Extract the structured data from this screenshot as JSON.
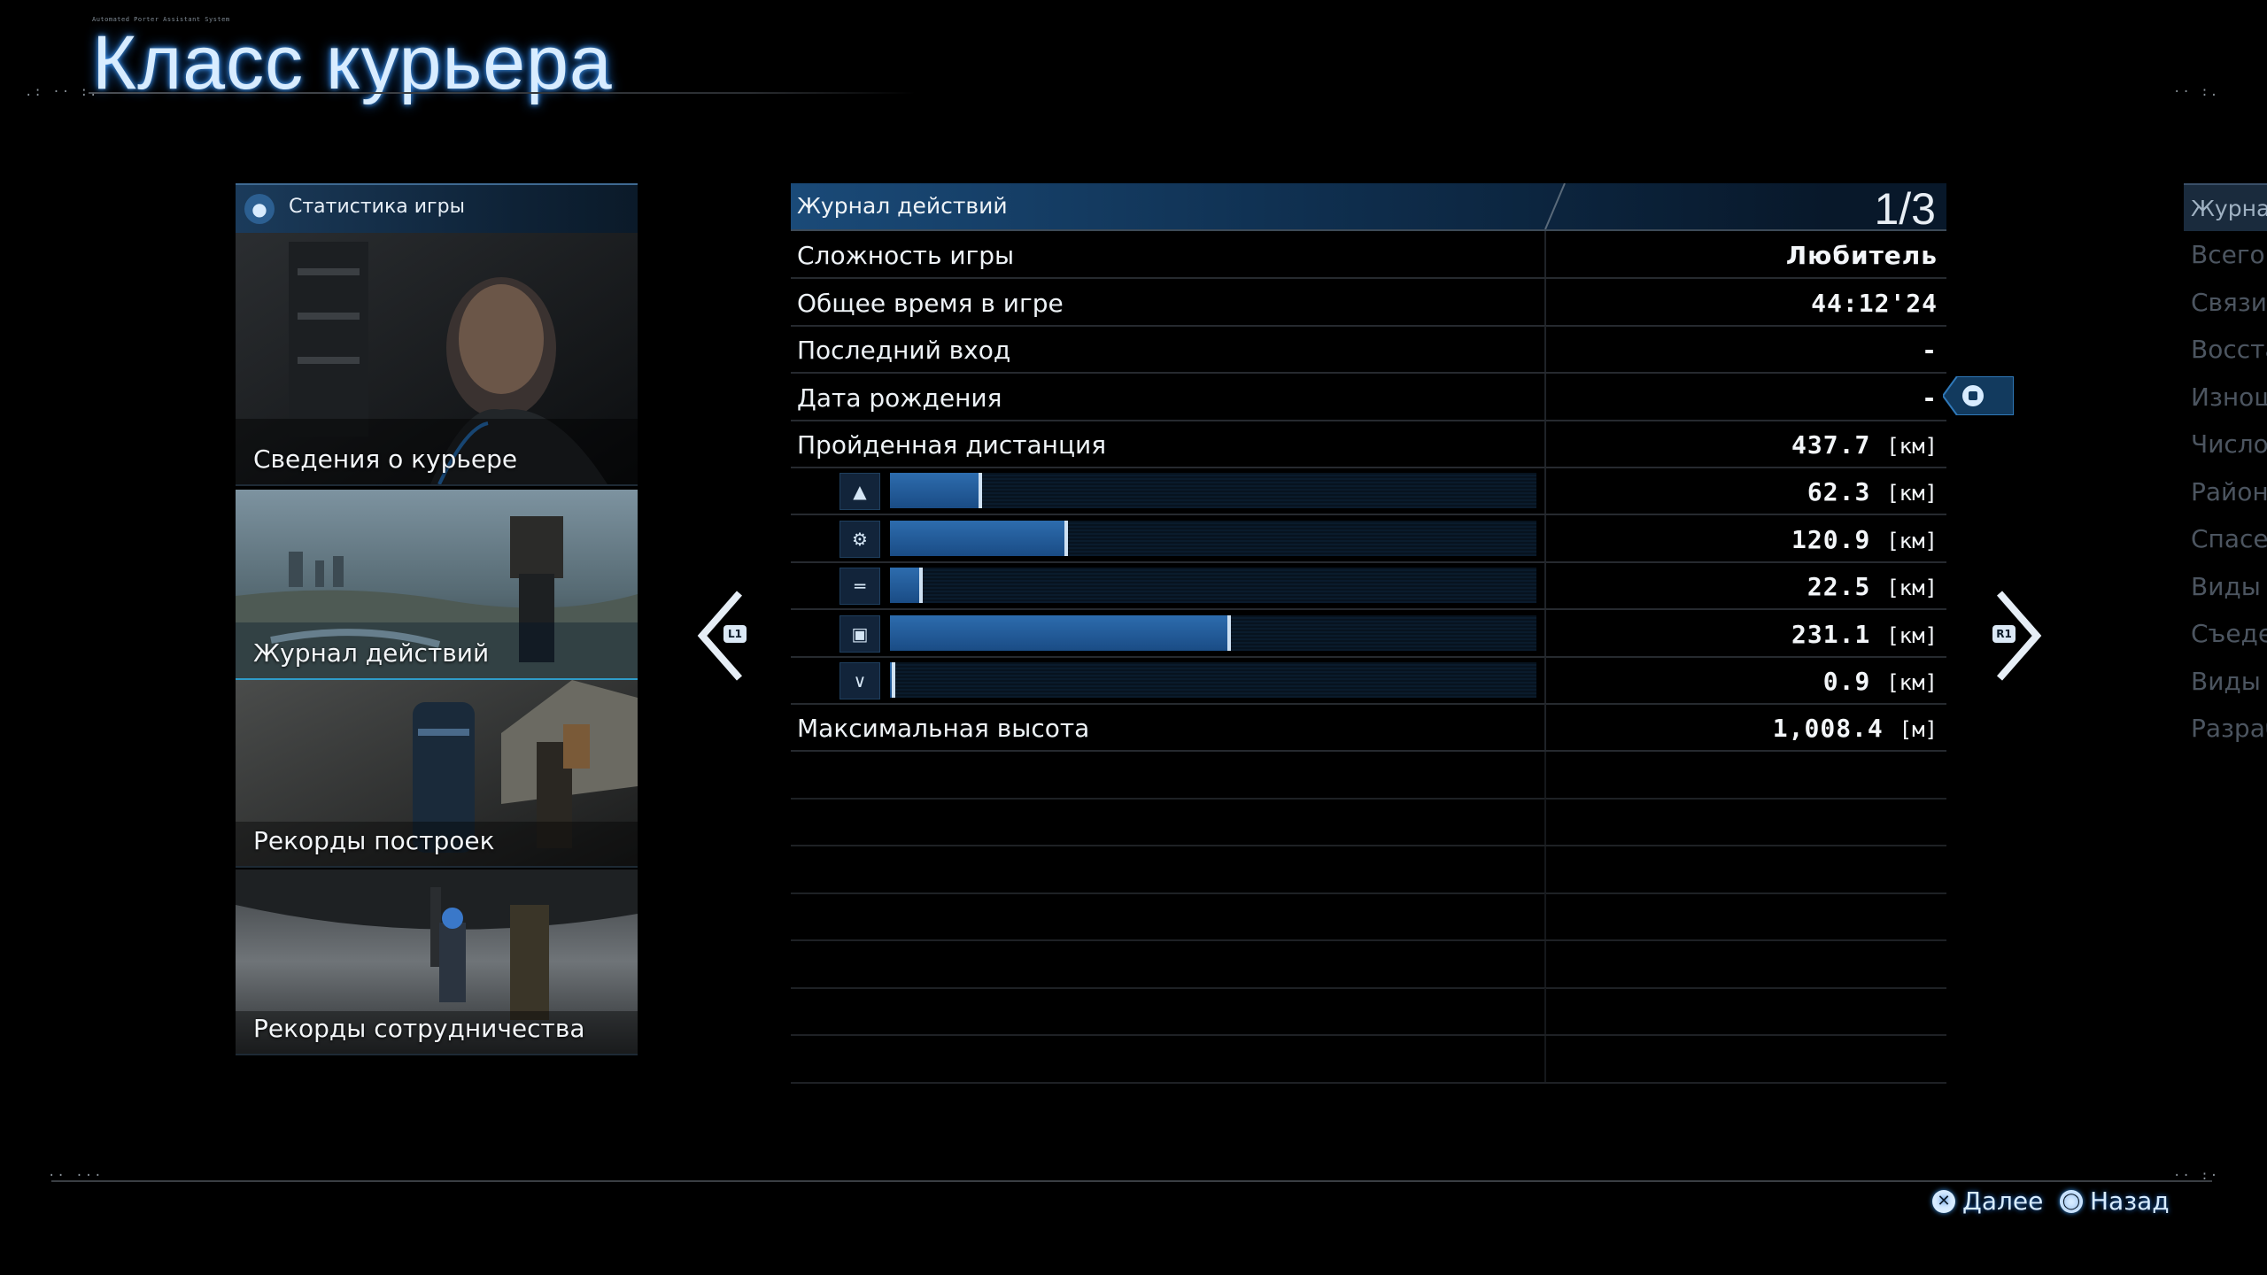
{
  "header": {
    "system_label": "Automated Porter Assistant System",
    "title": "Класс курьера"
  },
  "left_menu": {
    "header_label": "Статистика игры",
    "header_icon": "gamepad-icon",
    "items": [
      {
        "label": "Сведения о курьере",
        "active": false
      },
      {
        "label": "Журнал действий",
        "active": true
      },
      {
        "label": "Рекорды построек",
        "active": false
      },
      {
        "label": "Рекорды сотрудничества",
        "active": false
      }
    ]
  },
  "stats": {
    "section_title": "Журнал действий",
    "page_indicator": "1/3",
    "rows": [
      {
        "label": "Сложность игры",
        "value": "Любитель"
      },
      {
        "label": "Общее время в игре",
        "value": "44:12'24"
      },
      {
        "label": "Последний вход",
        "value": "-"
      },
      {
        "label": "Дата рождения",
        "value": "-"
      },
      {
        "label": "Пройденная дистанция",
        "value": "437.7",
        "unit": "[км]"
      }
    ],
    "distance_breakdown": [
      {
        "icon": "footsteps-icon",
        "value": "62.3",
        "unit": "[км]",
        "fraction": 0.142
      },
      {
        "icon": "motorbike-icon",
        "value": "120.9",
        "unit": "[км]",
        "fraction": 0.276
      },
      {
        "icon": "zipline-icon",
        "value": "22.5",
        "unit": "[км]",
        "fraction": 0.051
      },
      {
        "icon": "truck-icon",
        "value": "231.1",
        "unit": "[км]",
        "fraction": 0.528
      },
      {
        "icon": "tool-icon",
        "value": "0.9",
        "unit": "[км]",
        "fraction": 0.002
      }
    ],
    "max_height": {
      "label": "Максимальная высота",
      "value": "1,008.4",
      "unit": "[м]"
    }
  },
  "nav": {
    "prev_badge": "L1",
    "next_badge": "R1",
    "touchpad_icon": "touchpad-icon"
  },
  "right_panel": {
    "header": "Журнал",
    "items": [
      "Всего д",
      "Связи",
      "Восста",
      "Изнош",
      "Число",
      "Районн",
      "Спасен",
      "Виды с",
      "Съеден",
      "Виды с",
      "Разраб"
    ]
  },
  "footer": {
    "next_label": "Далее",
    "next_icon": "cross-button-icon",
    "back_label": "Назад",
    "back_icon": "circle-button-icon"
  },
  "colors": {
    "accent": "#2f9cc9",
    "title_glow": "#4aa3ff",
    "bar_fill": "#2d6cae"
  }
}
